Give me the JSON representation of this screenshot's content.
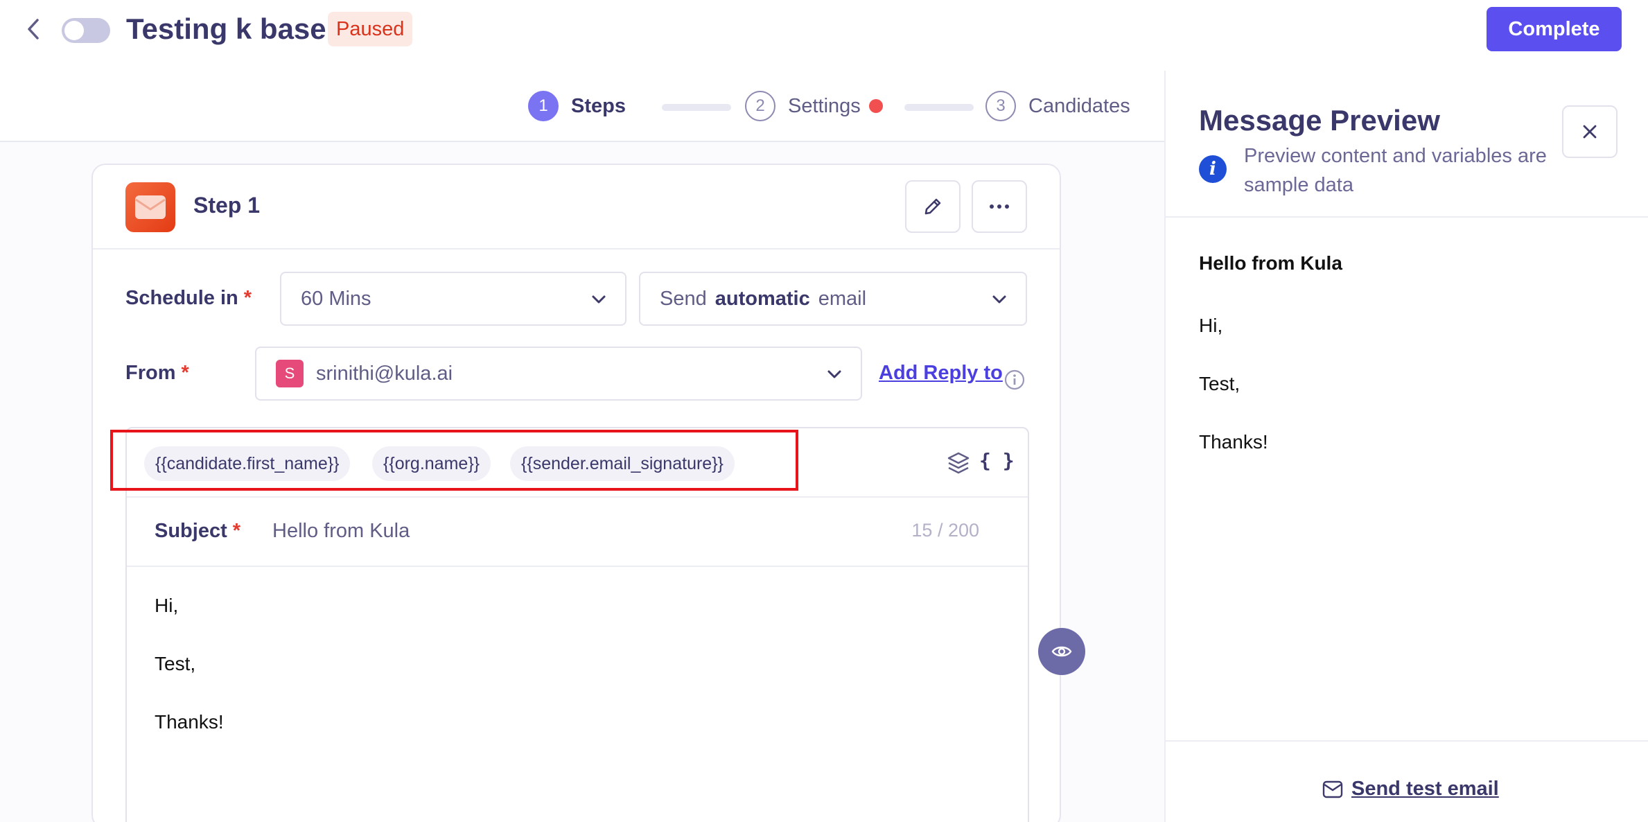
{
  "header": {
    "title": "Testing k base",
    "status": "Paused",
    "complete_label": "Complete"
  },
  "stepper": {
    "steps": [
      {
        "number": "1",
        "label": "Steps",
        "active": true
      },
      {
        "number": "2",
        "label": "Settings",
        "active": false
      },
      {
        "number": "3",
        "label": "Candidates",
        "active": false
      }
    ]
  },
  "step_card": {
    "title": "Step 1",
    "schedule": {
      "label": "Schedule in",
      "required": "*",
      "value": "60 Mins"
    },
    "send_mode": {
      "prefix": "Send",
      "mode": "automatic",
      "suffix": "email"
    },
    "from": {
      "label": "From",
      "required": "*",
      "avatar_letter": "S",
      "value": "srinithi@kula.ai"
    },
    "add_reply_to": "Add Reply to",
    "variables": [
      "{{candidate.first_name}}",
      "{{org.name}}",
      "{{sender.email_signature}}"
    ],
    "variables_toggle": "{ }",
    "subject": {
      "label": "Subject",
      "required": "*",
      "value": "Hello from Kula",
      "counter": "15 / 200"
    },
    "body_lines": [
      "Hi,",
      "Test,",
      "Thanks!"
    ]
  },
  "preview": {
    "title": "Message Preview",
    "info": "Preview content and variables are sample data",
    "subject": "Hello from Kula",
    "body_lines": [
      "Hi,",
      "Test,",
      "Thanks!"
    ],
    "send_test_label": "Send test email"
  },
  "colors": {
    "primary": "#5b4ff0",
    "paused_text": "#d9331c",
    "paused_bg": "#fde9e3",
    "highlight": "#e8141c"
  }
}
